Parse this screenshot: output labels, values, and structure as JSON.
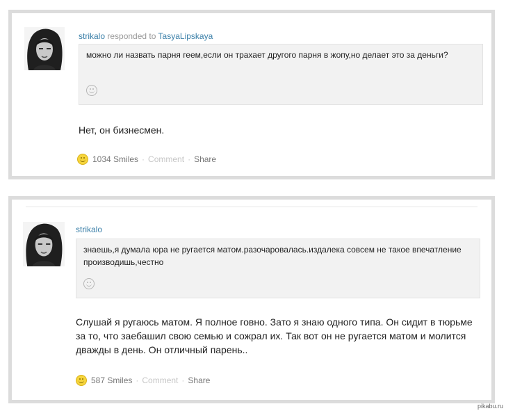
{
  "posts": [
    {
      "author": "strikalo",
      "responded_text": "responded to",
      "responded_to": "TasyaLipskaya",
      "quote": "можно ли назвать парня геем,если он трахает другого парня в жопу,но делает это за деньги?",
      "reply": "Нет, он бизнесмен.",
      "smiles": "1034 Smiles",
      "comment": "Comment",
      "share": "Share",
      "sep": "·"
    },
    {
      "author": "strikalo",
      "quote": "знаешь,я думала юра не ругается матом.разочаровалась.издалека совсем не такое впечатление производишь,честно",
      "reply": "Слушай я ругаюсь матом. Я полное говно. Зато я знаю одного типа. Он сидит в тюрьме за то, что заебашил свою семью и сожрал их. Так вот он не ругается матом и молится дважды в день. Он отличный парень..",
      "smiles": "587 Smiles",
      "comment": "Comment",
      "share": "Share",
      "sep": "·"
    }
  ],
  "watermark": "pikabu.ru",
  "colors": {
    "username": "#3a7fa8",
    "smile": "#f6d53c",
    "quote_bg": "#f2f2f2",
    "border": "#dcdcdc"
  }
}
